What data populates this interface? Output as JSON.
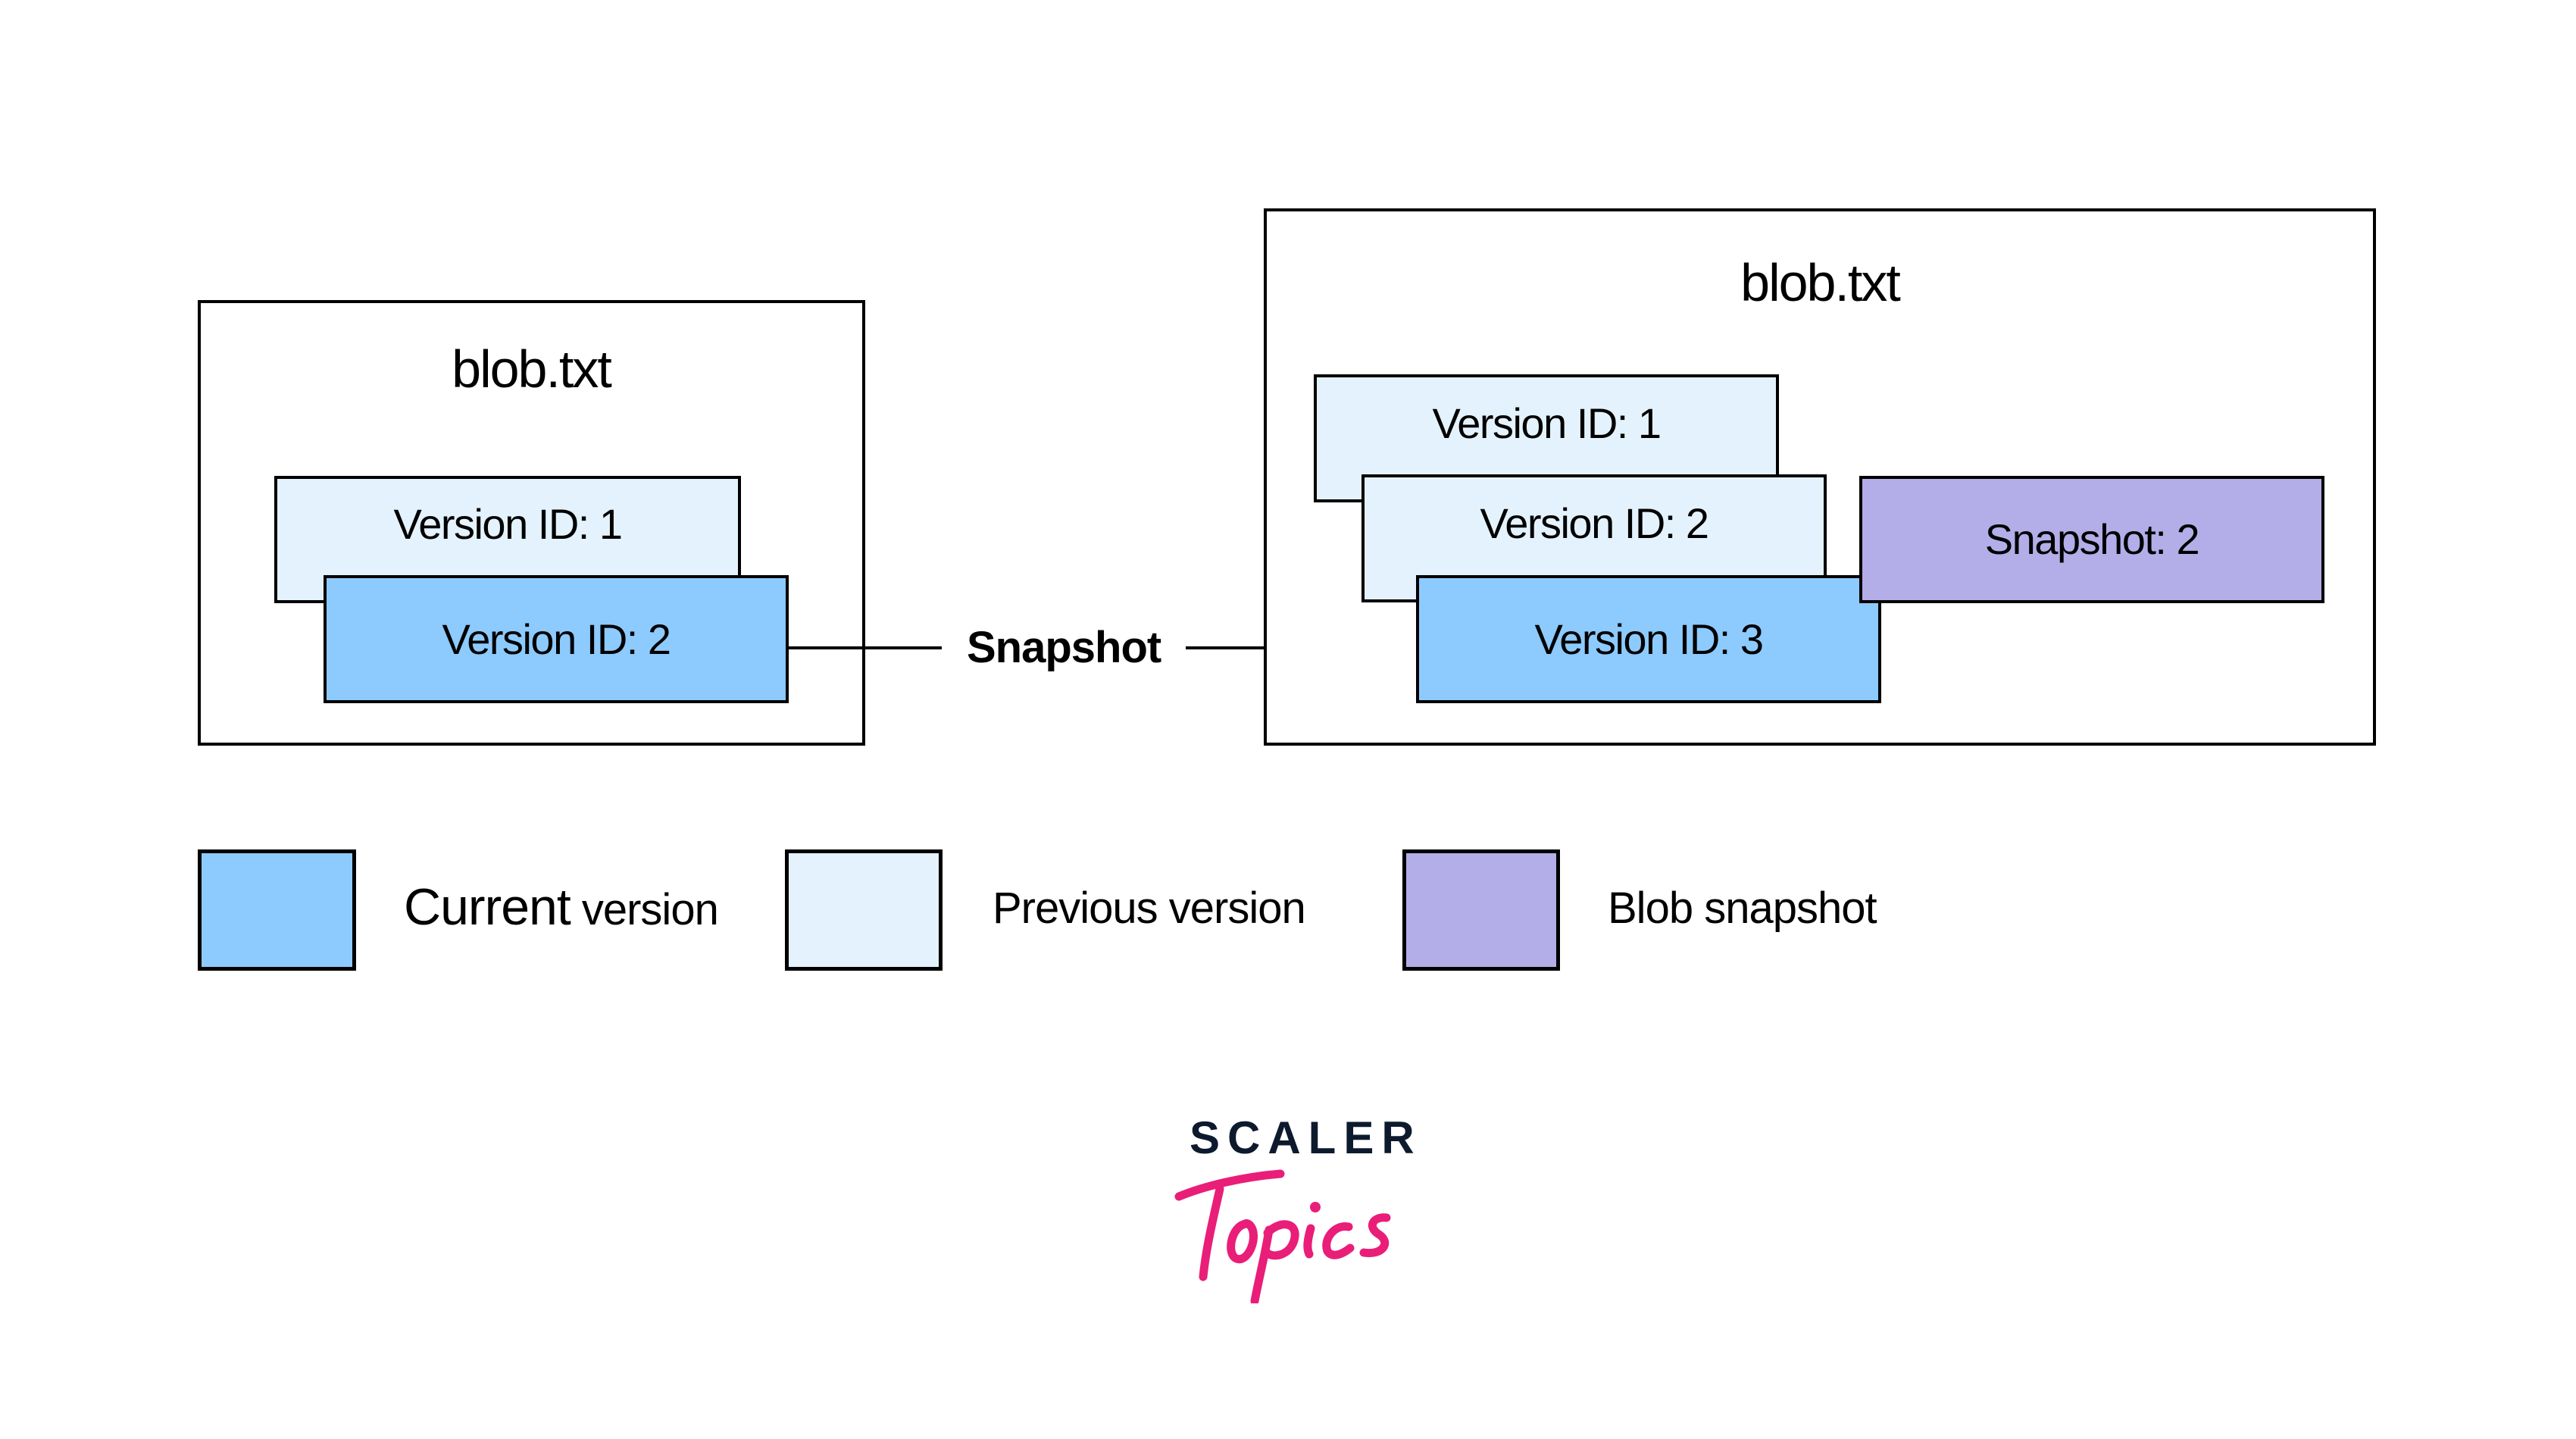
{
  "colors": {
    "current_version": "#8DCAFD",
    "previous_version": "#E4F2FD",
    "blob_snapshot": "#B3AEE8",
    "stroke": "#000000",
    "logo_dark": "#0D1A2E",
    "logo_pink": "#E91E78"
  },
  "before": {
    "title": "blob.txt",
    "versions": [
      {
        "label": "Version ID: 1",
        "state": "previous"
      },
      {
        "label": "Version ID: 2",
        "state": "current"
      }
    ]
  },
  "transition": {
    "label": "Snapshot"
  },
  "after": {
    "title": "blob.txt",
    "versions": [
      {
        "label": "Version ID: 1",
        "state": "previous"
      },
      {
        "label": "Version ID: 2",
        "state": "previous"
      },
      {
        "label": "Version ID: 3",
        "state": "current"
      }
    ],
    "snapshot": {
      "label": "Snapshot: 2",
      "state": "snapshot"
    }
  },
  "legend": [
    {
      "label_main": "Current",
      "label_rest": " version",
      "state": "current"
    },
    {
      "label": "Previous version",
      "state": "previous"
    },
    {
      "label": "Blob snapshot",
      "state": "snapshot"
    }
  ],
  "logo": {
    "top": "SCALER",
    "bottom": "Topics"
  }
}
